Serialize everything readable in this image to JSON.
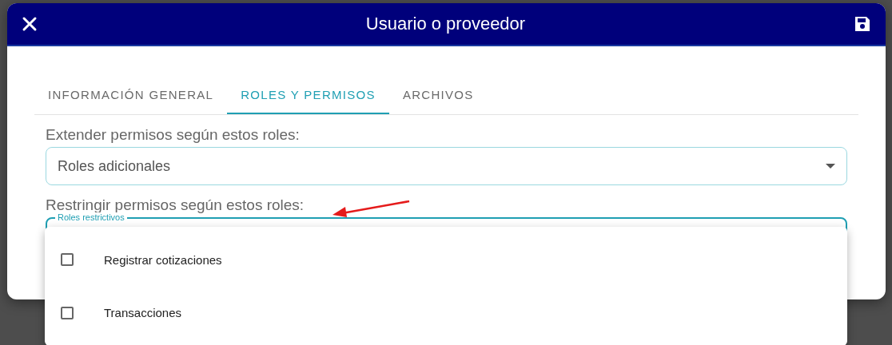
{
  "dialog": {
    "title": "Usuario o proveedor"
  },
  "tabs": [
    {
      "label": "INFORMACIÓN GENERAL",
      "selected": false
    },
    {
      "label": "ROLES Y PERMISOS",
      "selected": true
    },
    {
      "label": "ARCHIVOS",
      "selected": false
    }
  ],
  "fields": [
    {
      "label": "Extender permisos según estos roles:",
      "placeholder": "Roles adicionales",
      "focused": false
    },
    {
      "label": "Restringir permisos según estos roles:",
      "floating_label": "Roles restrictivos",
      "focused": true
    }
  ],
  "menu": {
    "options": [
      {
        "label": "Registrar cotizaciones",
        "checked": false
      },
      {
        "label": "Transacciones",
        "checked": false
      }
    ]
  }
}
